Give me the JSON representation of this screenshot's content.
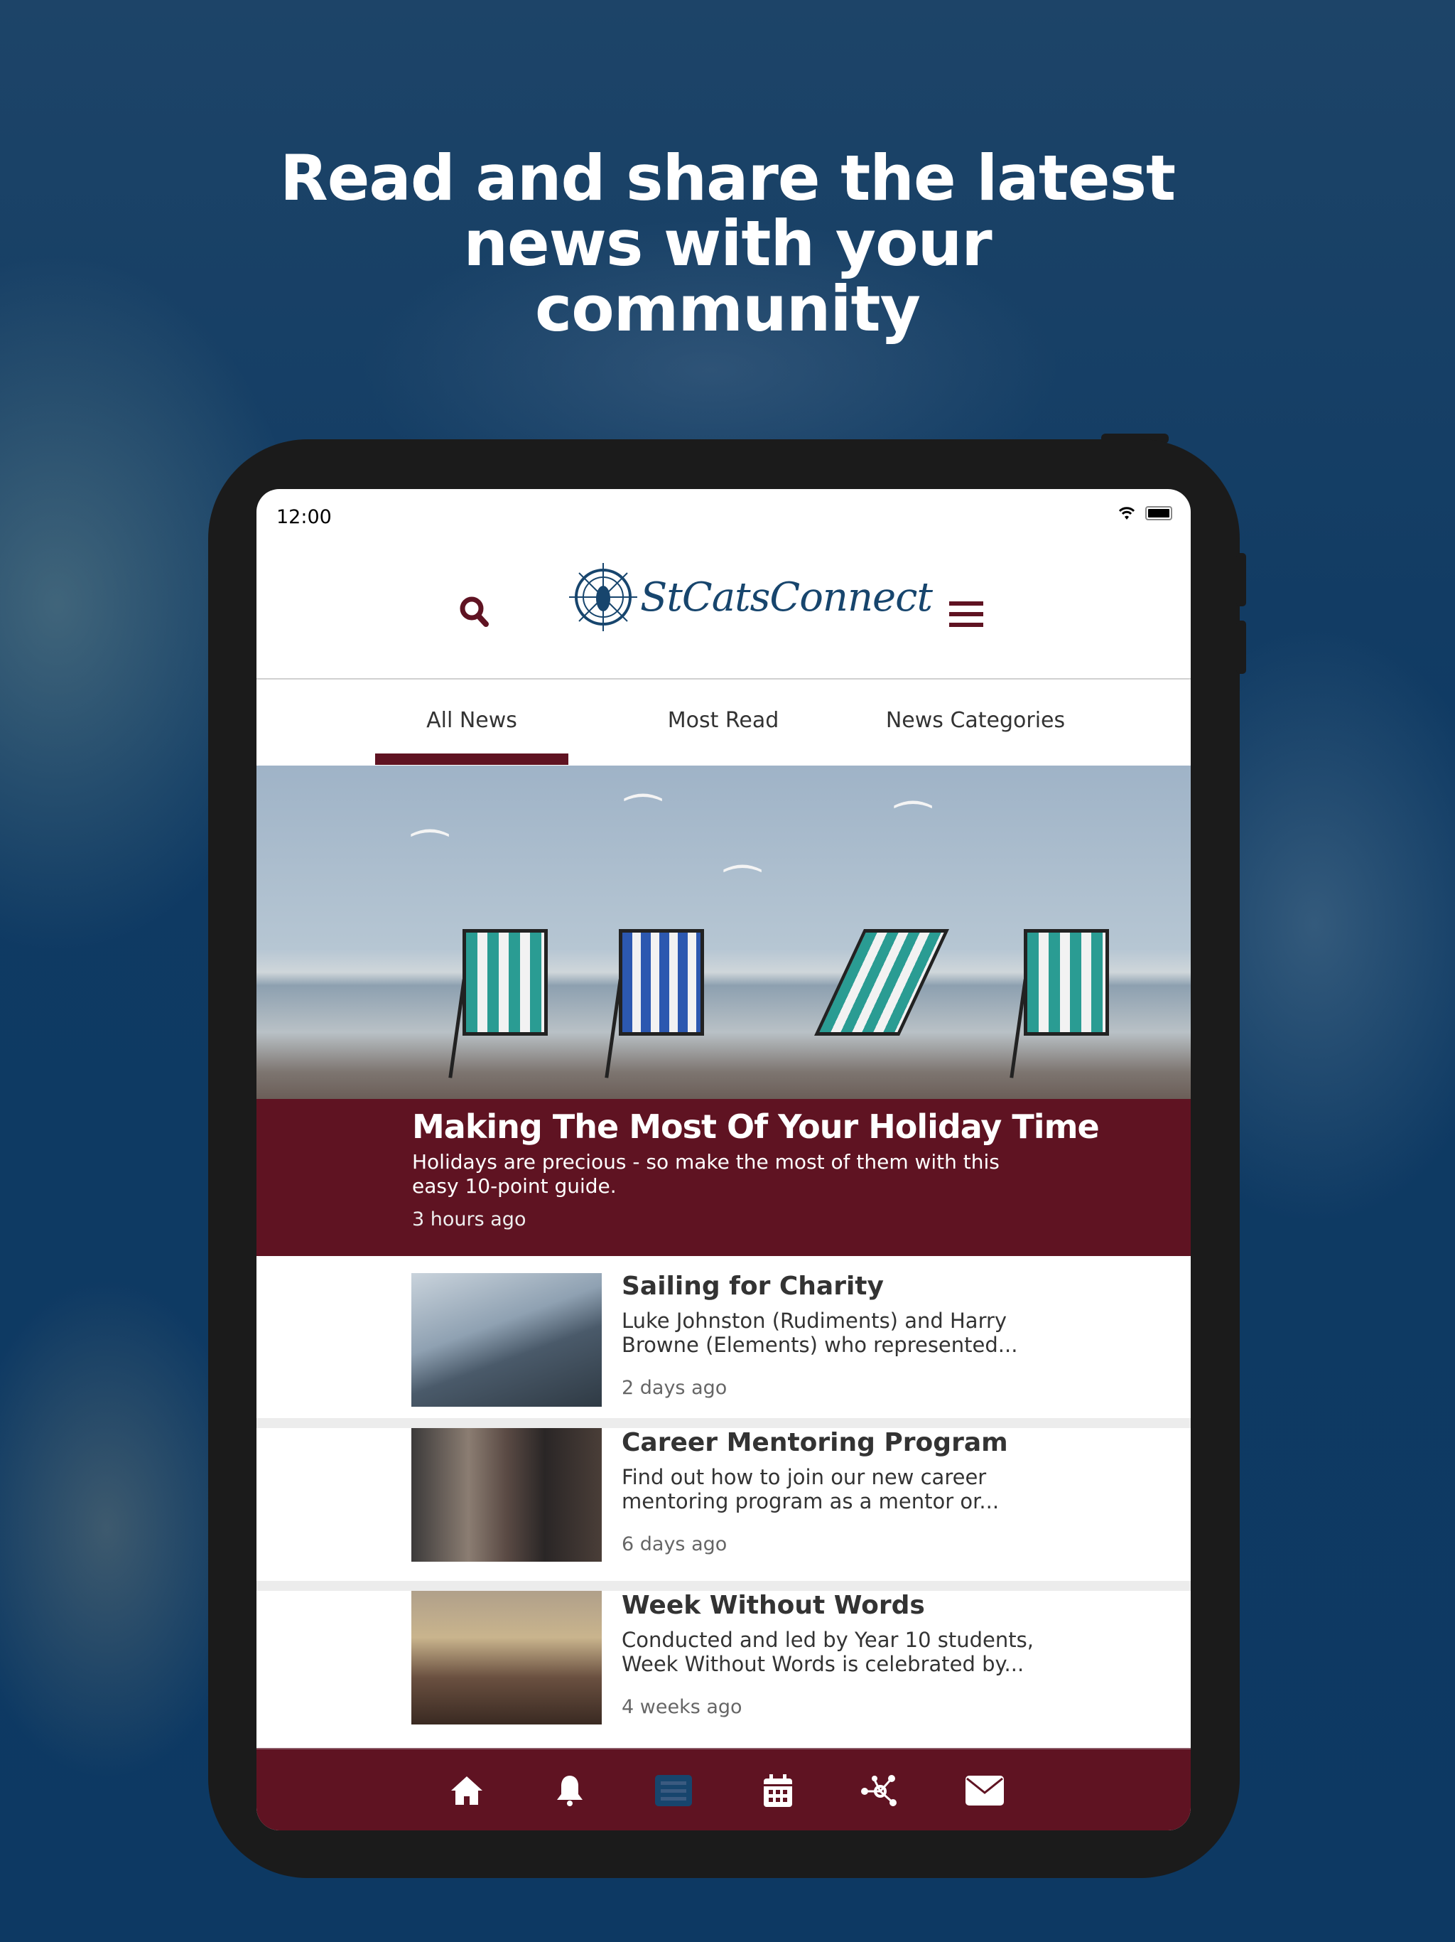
{
  "headline": {
    "line1": "Read and share the latest",
    "line2": "news with your",
    "line3": "community"
  },
  "status_bar": {
    "time": "12:00"
  },
  "header": {
    "logo_text": "StCatsConnect"
  },
  "tabs": [
    {
      "label": "All News",
      "active": true
    },
    {
      "label": "Most Read"
    },
    {
      "label": "News Categories"
    }
  ],
  "featured": {
    "title": "Making The Most Of Your Holiday Time",
    "summary": "Holidays are precious - so make the most of them with this easy 10-point guide.",
    "time": "3 hours ago"
  },
  "articles": [
    {
      "title": "Sailing for Charity",
      "summary": "Luke Johnston (Rudiments) and Harry Browne (Elements) who represented...",
      "time": "2 days ago"
    },
    {
      "title": "Career Mentoring Program",
      "summary": "Find out how to join our new career mentoring program as a mentor or...",
      "time": "6 days ago"
    },
    {
      "title": "Week Without Words",
      "summary": "Conducted and led by Year 10 students, Week Without Words is celebrated by...",
      "time": "4 weeks ago"
    }
  ],
  "bottom_nav": [
    {
      "icon": "home-icon"
    },
    {
      "icon": "bell-icon"
    },
    {
      "icon": "news-icon",
      "active": true
    },
    {
      "icon": "calendar-icon"
    },
    {
      "icon": "network-icon"
    },
    {
      "icon": "envelope-icon"
    }
  ],
  "colors": {
    "brand_maroon": "#5f1322",
    "brand_navy": "#17456d",
    "background": "#0f3a63"
  }
}
